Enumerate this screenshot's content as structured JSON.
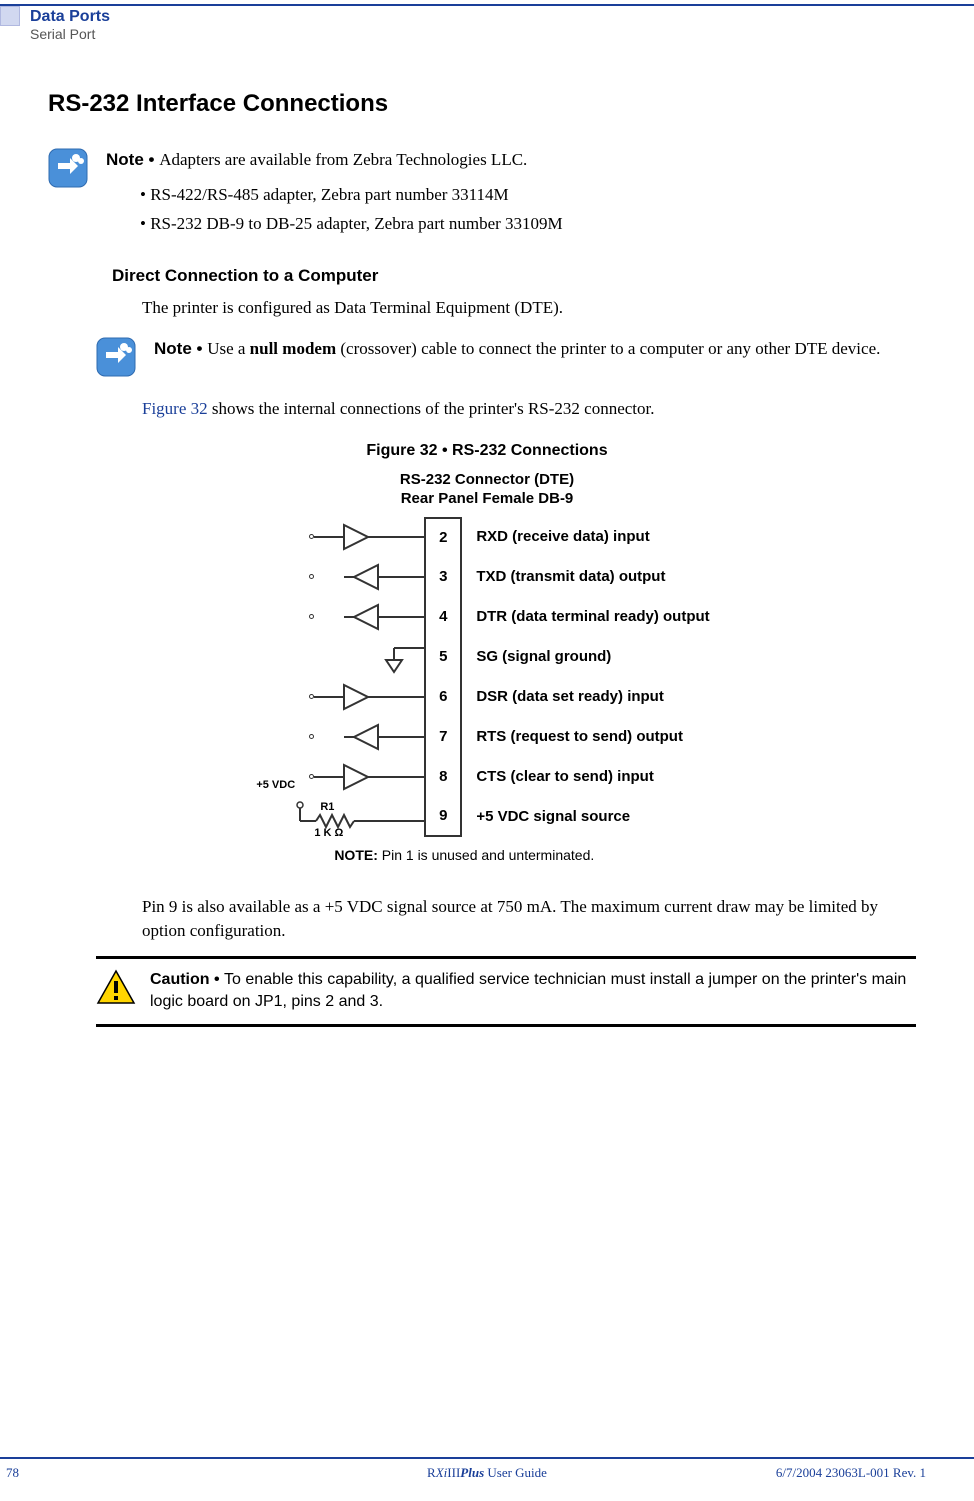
{
  "header": {
    "title": "Data Ports",
    "subtitle": "Serial Port"
  },
  "h1": "RS-232 Interface Connections",
  "note1": {
    "label": "Note • ",
    "text": "Adapters are available from Zebra Technologies LLC.",
    "bullets": [
      "RS-422/RS-485 adapter, Zebra part number 33114M",
      "RS-232 DB-9 to DB-25 adapter, Zebra part number 33109M"
    ]
  },
  "h2": "Direct Connection to a Computer",
  "para1": "The printer is configured as Data Terminal Equipment (DTE).",
  "note2": {
    "label": "Note • ",
    "text_before": "Use a ",
    "bold": "null modem",
    "text_after": " (crossover) cable to connect the printer to a computer or any other DTE device."
  },
  "para2_a": "Figure 32",
  "para2_b": " shows the internal connections of the printer's RS-232 connector.",
  "figure": {
    "caption": "Figure 32 • RS-232 Connections",
    "conn_line1": "RS-232 Connector (DTE)",
    "conn_line2": "Rear Panel Female DB-9",
    "pins": [
      {
        "num": "2",
        "label": "RXD (receive data) input",
        "dir": "in"
      },
      {
        "num": "3",
        "label": "TXD (transmit data) output",
        "dir": "out"
      },
      {
        "num": "4",
        "label": "DTR (data terminal ready) output",
        "dir": "out"
      },
      {
        "num": "5",
        "label": "SG (signal ground)",
        "dir": "gnd"
      },
      {
        "num": "6",
        "label": "DSR (data set ready) input",
        "dir": "in"
      },
      {
        "num": "7",
        "label": "RTS (request to send) output",
        "dir": "out"
      },
      {
        "num": "8",
        "label": "CTS (clear to send) input",
        "dir": "in"
      },
      {
        "num": "9",
        "label": " +5 VDC signal source",
        "dir": "src"
      }
    ],
    "vdc": "+5 VDC",
    "r1": "R1",
    "res": "1 K Ω",
    "footnote_label": "NOTE:",
    "footnote_text": "  Pin 1 is unused and unterminated."
  },
  "para3": "Pin 9 is also available as a +5 VDC signal source at 750 mA. The maximum current draw may be limited by option configuration.",
  "caution": {
    "label": "Caution • ",
    "text": "To enable this capability, a qualified service technician must install a jumper on the printer's main logic board on JP1, pins 2 and 3."
  },
  "footer": {
    "page": "78",
    "guide_pre": "R",
    "guide_xi": "Xi",
    "guide_iii": "III",
    "guide_plus": "Plus",
    "guide_post": " User Guide",
    "right": "6/7/2004    23063L-001 Rev. 1"
  }
}
